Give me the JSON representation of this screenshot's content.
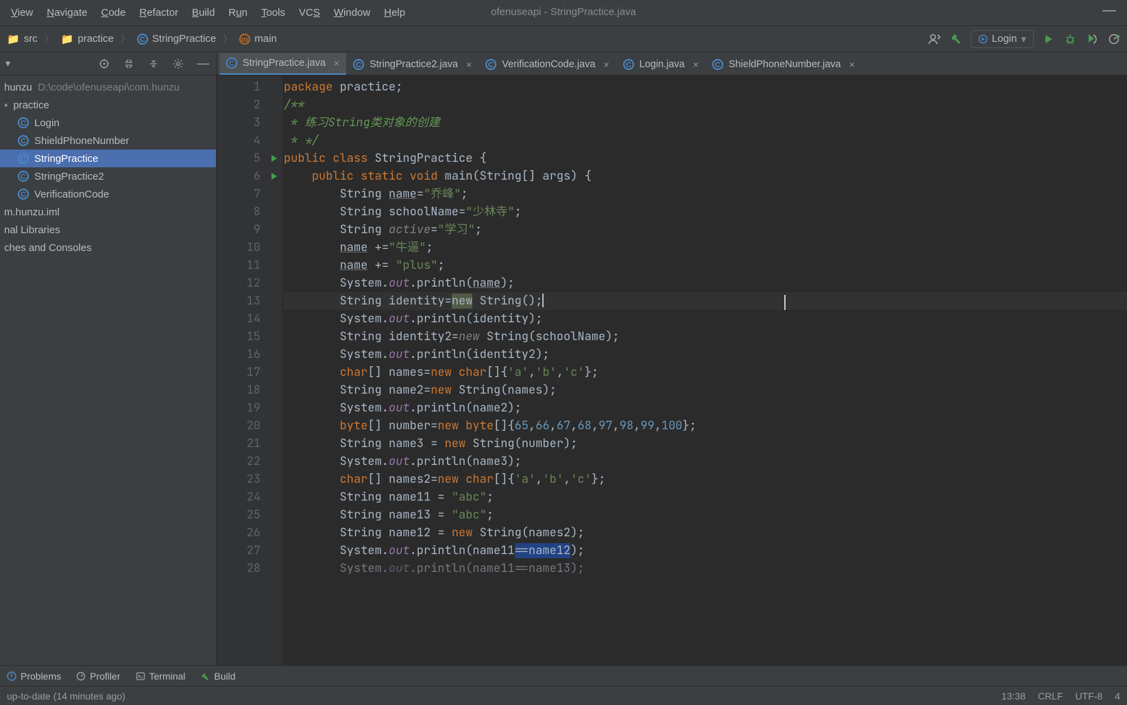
{
  "window_title": "ofenuseapi - StringPractice.java",
  "menu": [
    "View",
    "Navigate",
    "Code",
    "Refactor",
    "Build",
    "Run",
    "Tools",
    "VCS",
    "Window",
    "Help"
  ],
  "menu_underline_idx": [
    0,
    0,
    0,
    0,
    0,
    1,
    0,
    2,
    0,
    0
  ],
  "breadcrumb": [
    {
      "label": "src",
      "icon": "folder"
    },
    {
      "label": "practice",
      "icon": "folder"
    },
    {
      "label": "StringPractice",
      "icon": "class"
    },
    {
      "label": "main",
      "icon": "method"
    }
  ],
  "run_config_label": "Login",
  "sidebar": {
    "root_name": "hunzu",
    "root_path": "D:\\code\\ofenuseapi\\com.hunzu",
    "nodes": [
      {
        "label": "practice",
        "kind": "pkg"
      },
      {
        "label": "Login",
        "kind": "class"
      },
      {
        "label": "ShieldPhoneNumber",
        "kind": "class"
      },
      {
        "label": "StringPractice",
        "kind": "class",
        "selected": true
      },
      {
        "label": "StringPractice2",
        "kind": "class"
      },
      {
        "label": "VerificationCode",
        "kind": "class"
      }
    ],
    "extras": [
      "m.hunzu.iml",
      "nal Libraries",
      "ches and Consoles"
    ]
  },
  "tabs": [
    {
      "label": "StringPractice.java",
      "active": true
    },
    {
      "label": "StringPractice2.java"
    },
    {
      "label": "VerificationCode.java"
    },
    {
      "label": "Login.java"
    },
    {
      "label": "ShieldPhoneNumber.java"
    }
  ],
  "chart_data": {
    "type": "source-code",
    "language": "java",
    "lines": [
      {
        "n": 1,
        "tokens": [
          [
            "k",
            "package"
          ],
          [
            "t",
            " practice"
          ],
          [
            "t",
            ";"
          ]
        ]
      },
      {
        "n": 2,
        "tokens": [
          [
            "cd",
            "/**"
          ]
        ]
      },
      {
        "n": 3,
        "tokens": [
          [
            "cd",
            " * 练习String类对象的创建"
          ]
        ]
      },
      {
        "n": 4,
        "tokens": [
          [
            "cd",
            " * */"
          ]
        ]
      },
      {
        "n": 5,
        "run": true,
        "tokens": [
          [
            "k",
            "public class"
          ],
          [
            "t",
            " StringPractice {"
          ]
        ]
      },
      {
        "n": 6,
        "run": true,
        "tokens": [
          [
            "t",
            "    "
          ],
          [
            "k",
            "public static void"
          ],
          [
            "t",
            " "
          ],
          [
            "t",
            "main"
          ],
          [
            "t",
            "(String[] args) {"
          ]
        ]
      },
      {
        "n": 7,
        "tokens": [
          [
            "t",
            "        String "
          ],
          [
            "ul",
            "name"
          ],
          [
            "t",
            "="
          ],
          [
            "s",
            "\"乔峰\""
          ],
          [
            "t",
            ";"
          ]
        ]
      },
      {
        "n": 8,
        "tokens": [
          [
            "t",
            "        String schoolName="
          ],
          [
            "s",
            "\"少林寺\""
          ],
          [
            "t",
            ";"
          ]
        ]
      },
      {
        "n": 9,
        "tokens": [
          [
            "t",
            "        String "
          ],
          [
            "c",
            "active"
          ],
          [
            "t",
            "="
          ],
          [
            "s",
            "\"学习\""
          ],
          [
            "t",
            ";"
          ]
        ]
      },
      {
        "n": 10,
        "tokens": [
          [
            "t",
            "        "
          ],
          [
            "ul",
            "name"
          ],
          [
            "t",
            " +="
          ],
          [
            "s",
            "\"牛逼\""
          ],
          [
            "t",
            ";"
          ]
        ]
      },
      {
        "n": 11,
        "tokens": [
          [
            "t",
            "        "
          ],
          [
            "ul",
            "name"
          ],
          [
            "t",
            " += "
          ],
          [
            "s",
            "\"plus\""
          ],
          [
            "t",
            ";"
          ]
        ]
      },
      {
        "n": 12,
        "tokens": [
          [
            "t",
            "        System."
          ],
          [
            "st",
            "out"
          ],
          [
            "t",
            ".println("
          ],
          [
            "ul",
            "name"
          ],
          [
            "t",
            ");"
          ]
        ]
      },
      {
        "n": 13,
        "current": true,
        "tokens": [
          [
            "t",
            "        String identity="
          ],
          [
            "selk",
            "new"
          ],
          [
            "t",
            " String();"
          ]
        ]
      },
      {
        "n": 14,
        "tokens": [
          [
            "t",
            "        System."
          ],
          [
            "st",
            "out"
          ],
          [
            "t",
            ".println(identity);"
          ]
        ]
      },
      {
        "n": 15,
        "tokens": [
          [
            "t",
            "        String identity2="
          ],
          [
            "c",
            "new"
          ],
          [
            "t",
            " String(schoolName);"
          ]
        ]
      },
      {
        "n": 16,
        "tokens": [
          [
            "t",
            "        System."
          ],
          [
            "st",
            "out"
          ],
          [
            "t",
            ".println(identity2);"
          ]
        ]
      },
      {
        "n": 17,
        "tokens": [
          [
            "t",
            "        "
          ],
          [
            "k",
            "char"
          ],
          [
            "t",
            "[] names="
          ],
          [
            "k",
            "new char"
          ],
          [
            "t",
            "[]{"
          ],
          [
            "s",
            "'a'"
          ],
          [
            "t",
            ","
          ],
          [
            "s",
            "'b'"
          ],
          [
            "t",
            ","
          ],
          [
            "s",
            "'c'"
          ],
          [
            "t",
            "};"
          ]
        ]
      },
      {
        "n": 18,
        "tokens": [
          [
            "t",
            "        String name2="
          ],
          [
            "k",
            "new"
          ],
          [
            "t",
            " String(names);"
          ]
        ]
      },
      {
        "n": 19,
        "tokens": [
          [
            "t",
            "        System."
          ],
          [
            "st",
            "out"
          ],
          [
            "t",
            ".println(name2);"
          ]
        ]
      },
      {
        "n": 20,
        "tokens": [
          [
            "t",
            "        "
          ],
          [
            "k",
            "byte"
          ],
          [
            "t",
            "[] number="
          ],
          [
            "k",
            "new byte"
          ],
          [
            "t",
            "[]{"
          ],
          [
            "n",
            "65"
          ],
          [
            "t",
            ","
          ],
          [
            "n",
            "66"
          ],
          [
            "t",
            ","
          ],
          [
            "n",
            "67"
          ],
          [
            "t",
            ","
          ],
          [
            "n",
            "68"
          ],
          [
            "t",
            ","
          ],
          [
            "n",
            "97"
          ],
          [
            "t",
            ","
          ],
          [
            "n",
            "98"
          ],
          [
            "t",
            ","
          ],
          [
            "n",
            "99"
          ],
          [
            "t",
            ","
          ],
          [
            "n",
            "100"
          ],
          [
            "t",
            "};"
          ]
        ]
      },
      {
        "n": 21,
        "tokens": [
          [
            "t",
            "        String name3 = "
          ],
          [
            "k",
            "new"
          ],
          [
            "t",
            " String(number);"
          ]
        ]
      },
      {
        "n": 22,
        "tokens": [
          [
            "t",
            "        System."
          ],
          [
            "st",
            "out"
          ],
          [
            "t",
            ".println(name3);"
          ]
        ]
      },
      {
        "n": 23,
        "tokens": [
          [
            "t",
            "        "
          ],
          [
            "k",
            "char"
          ],
          [
            "t",
            "[] names2="
          ],
          [
            "k",
            "new char"
          ],
          [
            "t",
            "[]{"
          ],
          [
            "s",
            "'a'"
          ],
          [
            "t",
            ","
          ],
          [
            "s",
            "'b'"
          ],
          [
            "t",
            ","
          ],
          [
            "s",
            "'c'"
          ],
          [
            "t",
            "};"
          ]
        ]
      },
      {
        "n": 24,
        "tokens": [
          [
            "t",
            "        String name11 = "
          ],
          [
            "s",
            "\"abc\""
          ],
          [
            "t",
            ";"
          ]
        ]
      },
      {
        "n": 25,
        "tokens": [
          [
            "t",
            "        String name13 = "
          ],
          [
            "s",
            "\"abc\""
          ],
          [
            "t",
            ";"
          ]
        ]
      },
      {
        "n": 26,
        "tokens": [
          [
            "t",
            "        String name12 = "
          ],
          [
            "k",
            "new"
          ],
          [
            "t",
            " String(names2);"
          ]
        ]
      },
      {
        "n": 27,
        "tokens": [
          [
            "t",
            "        System."
          ],
          [
            "st",
            "out"
          ],
          [
            "t",
            ".println(name11"
          ],
          [
            "sel",
            "==name12"
          ],
          [
            "t",
            ");"
          ]
        ]
      },
      {
        "n": 28,
        "faded": true,
        "tokens": [
          [
            "t",
            "        System."
          ],
          [
            "st",
            "out"
          ],
          [
            "t",
            ".println(name11==name13);"
          ]
        ]
      }
    ]
  },
  "bottom_tools": [
    "Problems",
    "Profiler",
    "Terminal",
    "Build"
  ],
  "status": {
    "left": "up-to-date (14 minutes ago)",
    "caret": "13:38",
    "lineend": "CRLF",
    "encoding": "UTF-8",
    "indent": "4"
  }
}
